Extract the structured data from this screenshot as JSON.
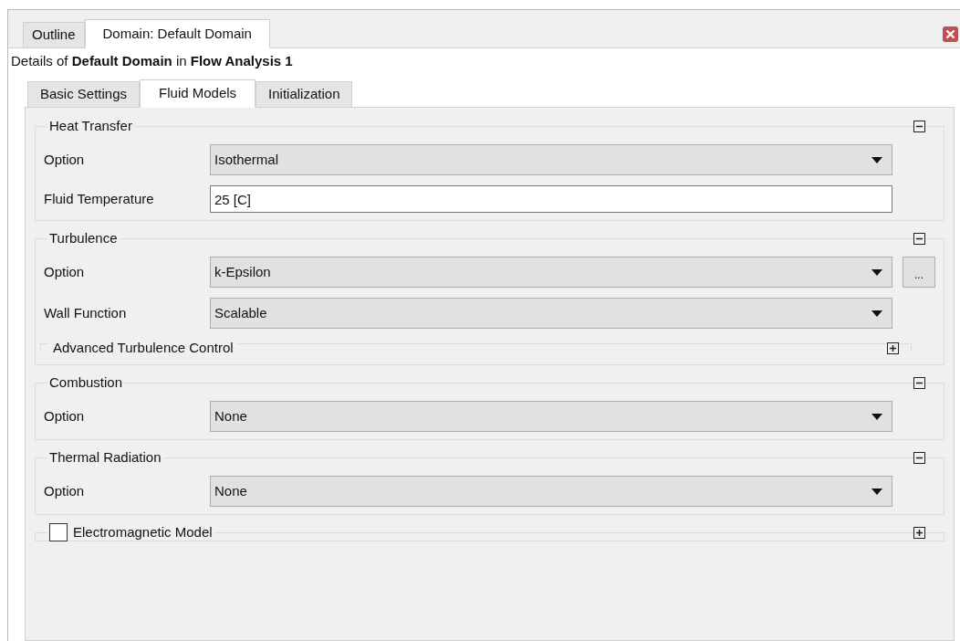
{
  "panel_tabs": [
    {
      "label": "Outline",
      "selected": false
    },
    {
      "label": "Domain: Default Domain",
      "selected": true
    }
  ],
  "details": "Details of **Default Domain** in **Flow Analysis 1**",
  "tabs": [
    {
      "label": "Basic Settings",
      "selected": false
    },
    {
      "label": "Fluid Models",
      "selected": true
    },
    {
      "label": "Initialization",
      "selected": false
    }
  ],
  "groups": [
    {
      "title": "Heat Transfer",
      "expanded": true,
      "fields": [
        {
          "kind": "dropdown",
          "label": "Option",
          "value": "Isothermal"
        },
        {
          "kind": "text",
          "label": "Fluid Temperature",
          "value": "25 [C]"
        }
      ]
    },
    {
      "title": "Turbulence",
      "expanded": true,
      "fields": [
        {
          "kind": "dropdown",
          "label": "Option",
          "value": "k-Epsilon",
          "extra_button": "..."
        },
        {
          "kind": "dropdown",
          "label": "Wall Function",
          "value": "Scalable"
        },
        {
          "kind": "subgroup",
          "label": "Advanced Turbulence Control",
          "expanded": false
        }
      ]
    },
    {
      "title": "Combustion",
      "expanded": true,
      "fields": [
        {
          "kind": "dropdown",
          "label": "Option",
          "value": "None"
        }
      ]
    },
    {
      "title": "Thermal Radiation",
      "expanded": true,
      "fields": [
        {
          "kind": "dropdown",
          "label": "Option",
          "value": "None"
        }
      ]
    },
    {
      "title": "Electromagnetic Model",
      "expanded": false,
      "checked": false
    }
  ]
}
